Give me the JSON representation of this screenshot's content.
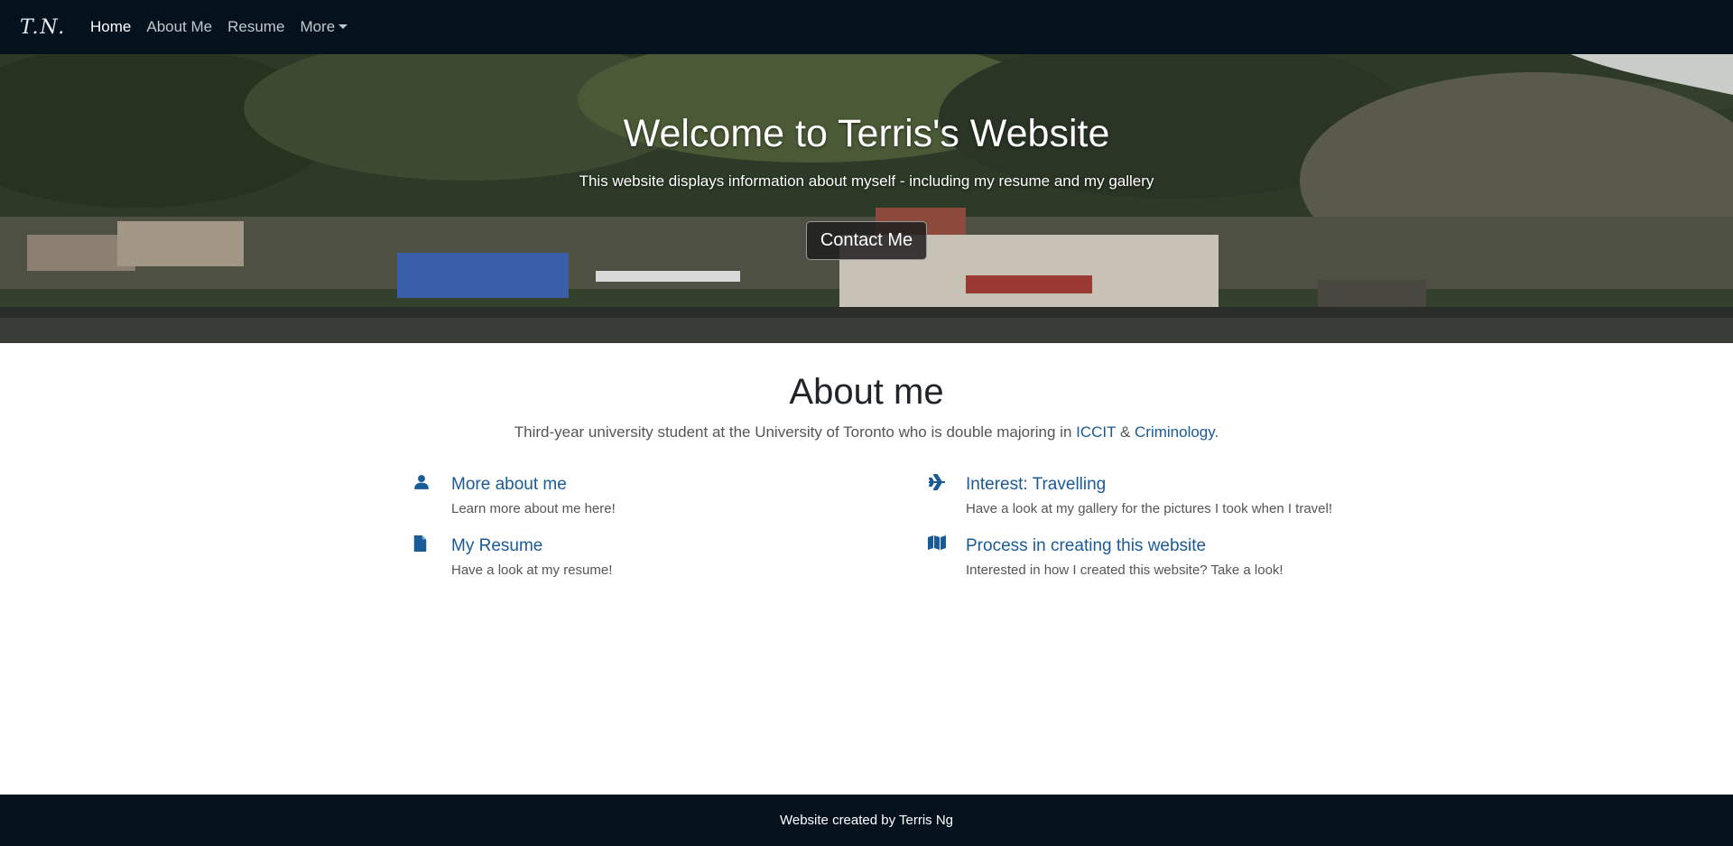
{
  "navbar": {
    "brand": "T.N.",
    "links": [
      {
        "label": "Home"
      },
      {
        "label": "About Me"
      },
      {
        "label": "Resume"
      },
      {
        "label": "More"
      }
    ]
  },
  "hero": {
    "title": "Welcome to Terris's Website",
    "subtitle": "This website displays information about myself - including my resume and my gallery",
    "button": "Contact Me"
  },
  "about": {
    "title": "About me",
    "desc_before": "Third-year university student at the University of Toronto who is double majoring in ",
    "link1": "ICCIT",
    "desc_mid": " & ",
    "link2": "Criminology",
    "desc_after": ".",
    "features": [
      {
        "icon": "user-icon",
        "title": "More about me",
        "desc": "Learn more about me here!"
      },
      {
        "icon": "plane-icon",
        "title": "Interest: Travelling",
        "desc": "Have a look at my gallery for the pictures I took when I travel!"
      },
      {
        "icon": "document-icon",
        "title": "My Resume",
        "desc": "Have a look at my resume!"
      },
      {
        "icon": "map-icon",
        "title": "Process in creating this website",
        "desc": "Interested in how I created this website? Take a look!"
      }
    ]
  },
  "footer": {
    "text": "Website created by Terris Ng"
  },
  "colors": {
    "navbar_bg": "#04121e",
    "accent": "#1a5a96"
  }
}
